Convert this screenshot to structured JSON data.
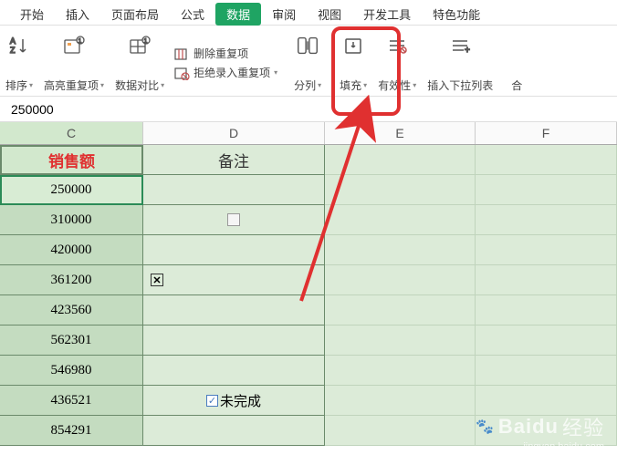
{
  "tabs": {
    "start": "开始",
    "insert": "插入",
    "page_layout": "页面布局",
    "formula": "公式",
    "data": "数据",
    "review": "审阅",
    "view": "视图",
    "dev": "开发工具",
    "special": "特色功能"
  },
  "ribbon": {
    "sort": "排序",
    "highlight_dup": "高亮重复项",
    "data_compare": "数据对比",
    "delete_dup": "删除重复项",
    "reject_dup": "拒绝录入重复项",
    "split_col": "分列",
    "fill": "填充",
    "validity": "有效性",
    "insert_dropdown": "插入下拉列表",
    "merge": "合"
  },
  "formula_bar": "250000",
  "columns": {
    "c": "C",
    "d": "D",
    "e": "E",
    "f": "F"
  },
  "headers": {
    "sales": "销售额",
    "remark": "备注"
  },
  "col_c_values": [
    "250000",
    "310000",
    "420000",
    "361200",
    "423560",
    "562301",
    "546980",
    "436521",
    "854291"
  ],
  "col_d": {
    "incomplete": "未完成"
  },
  "watermark": {
    "brand": "Baidu",
    "suffix": "经验",
    "url": "jingyan.baidu.com"
  }
}
